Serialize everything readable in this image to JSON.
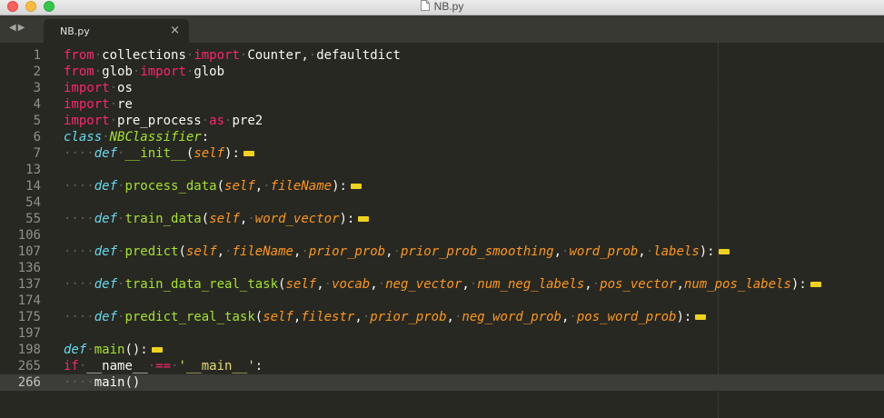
{
  "window": {
    "title": "NB.py"
  },
  "tabs": [
    {
      "label": "NB.py",
      "close": "×"
    }
  ],
  "lines": [
    {
      "n": "1",
      "tokens": [
        [
          "kw",
          "from"
        ],
        [
          "ws",
          "·"
        ],
        [
          "",
          "collections"
        ],
        [
          "ws",
          "·"
        ],
        [
          "kw",
          "import"
        ],
        [
          "ws",
          "·"
        ],
        [
          "",
          "Counter,"
        ],
        [
          "ws",
          "·"
        ],
        [
          "",
          "defaultdict"
        ]
      ]
    },
    {
      "n": "2",
      "tokens": [
        [
          "kw",
          "from"
        ],
        [
          "ws",
          "·"
        ],
        [
          "",
          "glob"
        ],
        [
          "ws",
          "·"
        ],
        [
          "kw",
          "import"
        ],
        [
          "ws",
          "·"
        ],
        [
          "",
          "glob"
        ]
      ]
    },
    {
      "n": "3",
      "tokens": [
        [
          "kw",
          "import"
        ],
        [
          "ws",
          "·"
        ],
        [
          "",
          "os"
        ]
      ]
    },
    {
      "n": "4",
      "tokens": [
        [
          "kw",
          "import"
        ],
        [
          "ws",
          "·"
        ],
        [
          "",
          "re"
        ]
      ]
    },
    {
      "n": "5",
      "tokens": [
        [
          "kw",
          "import"
        ],
        [
          "ws",
          "·"
        ],
        [
          "",
          "pre_process"
        ],
        [
          "ws",
          "·"
        ],
        [
          "kw",
          "as"
        ],
        [
          "ws",
          "·"
        ],
        [
          "",
          "pre2"
        ]
      ]
    },
    {
      "n": "6",
      "tokens": [
        [
          "st",
          "class"
        ],
        [
          "ws",
          "·"
        ],
        [
          "cl",
          "NBClassifier"
        ],
        [
          "",
          ":"
        ]
      ]
    },
    {
      "n": "7",
      "tokens": [
        [
          "ws",
          "····"
        ],
        [
          "st",
          "def"
        ],
        [
          "ws",
          "·"
        ],
        [
          "fn",
          "__init__"
        ],
        [
          "",
          "("
        ],
        [
          "pa",
          "self"
        ],
        [
          "",
          "):"
        ]
      ],
      "fold": true
    },
    {
      "n": "13",
      "tokens": []
    },
    {
      "n": "14",
      "tokens": [
        [
          "ws",
          "····"
        ],
        [
          "st",
          "def"
        ],
        [
          "ws",
          "·"
        ],
        [
          "fn",
          "process_data"
        ],
        [
          "",
          "("
        ],
        [
          "pa",
          "self"
        ],
        [
          "",
          ","
        ],
        [
          "ws",
          "·"
        ],
        [
          "pa",
          "fileName"
        ],
        [
          "",
          "):"
        ]
      ],
      "fold": true
    },
    {
      "n": "54",
      "tokens": []
    },
    {
      "n": "55",
      "tokens": [
        [
          "ws",
          "····"
        ],
        [
          "st",
          "def"
        ],
        [
          "ws",
          "·"
        ],
        [
          "fn",
          "train_data"
        ],
        [
          "",
          "("
        ],
        [
          "pa",
          "self"
        ],
        [
          "",
          ","
        ],
        [
          "ws",
          "·"
        ],
        [
          "pa",
          "word_vector"
        ],
        [
          "",
          "):"
        ]
      ],
      "fold": true
    },
    {
      "n": "106",
      "tokens": []
    },
    {
      "n": "107",
      "tokens": [
        [
          "ws",
          "····"
        ],
        [
          "st",
          "def"
        ],
        [
          "ws",
          "·"
        ],
        [
          "fn",
          "predict"
        ],
        [
          "",
          "("
        ],
        [
          "pa",
          "self"
        ],
        [
          "",
          ","
        ],
        [
          "ws",
          "·"
        ],
        [
          "pa",
          "fileName"
        ],
        [
          "",
          ","
        ],
        [
          "ws",
          "·"
        ],
        [
          "pa",
          "prior_prob"
        ],
        [
          "",
          ","
        ],
        [
          "ws",
          "·"
        ],
        [
          "pa",
          "prior_prob_smoothing"
        ],
        [
          "",
          ","
        ],
        [
          "ws",
          "·"
        ],
        [
          "pa",
          "word_prob"
        ],
        [
          "",
          ","
        ],
        [
          "ws",
          "·"
        ],
        [
          "pa",
          "labels"
        ],
        [
          "",
          "):"
        ]
      ],
      "fold": true
    },
    {
      "n": "136",
      "tokens": []
    },
    {
      "n": "137",
      "tokens": [
        [
          "ws",
          "····"
        ],
        [
          "st",
          "def"
        ],
        [
          "ws",
          "·"
        ],
        [
          "fn",
          "train_data_real_task"
        ],
        [
          "",
          "("
        ],
        [
          "pa",
          "self"
        ],
        [
          "",
          ","
        ],
        [
          "ws",
          "·"
        ],
        [
          "pa",
          "vocab"
        ],
        [
          "",
          ","
        ],
        [
          "ws",
          "·"
        ],
        [
          "pa",
          "neg_vector"
        ],
        [
          "",
          ","
        ],
        [
          "ws",
          "·"
        ],
        [
          "pa",
          "num_neg_labels"
        ],
        [
          "",
          ","
        ],
        [
          "ws",
          "·"
        ],
        [
          "pa",
          "pos_vector"
        ],
        [
          "",
          ","
        ],
        [
          "pa",
          "num_pos_labels"
        ],
        [
          "",
          "):"
        ]
      ],
      "fold": true
    },
    {
      "n": "174",
      "tokens": []
    },
    {
      "n": "175",
      "tokens": [
        [
          "ws",
          "····"
        ],
        [
          "st",
          "def"
        ],
        [
          "ws",
          "·"
        ],
        [
          "fn",
          "predict_real_task"
        ],
        [
          "",
          "("
        ],
        [
          "pa",
          "self"
        ],
        [
          "",
          ","
        ],
        [
          "pa",
          "filestr"
        ],
        [
          "",
          ","
        ],
        [
          "ws",
          "·"
        ],
        [
          "pa",
          "prior_prob"
        ],
        [
          "",
          ","
        ],
        [
          "ws",
          "·"
        ],
        [
          "pa",
          "neg_word_prob"
        ],
        [
          "",
          ","
        ],
        [
          "ws",
          "·"
        ],
        [
          "pa",
          "pos_word_prob"
        ],
        [
          "",
          "):"
        ]
      ],
      "fold": true
    },
    {
      "n": "197",
      "tokens": []
    },
    {
      "n": "198",
      "tokens": [
        [
          "st",
          "def"
        ],
        [
          "ws",
          "·"
        ],
        [
          "fn",
          "main"
        ],
        [
          "",
          "():"
        ]
      ],
      "fold": true
    },
    {
      "n": "265",
      "tokens": [
        [
          "kw",
          "if"
        ],
        [
          "ws",
          "·"
        ],
        [
          "",
          "__name__"
        ],
        [
          "ws",
          "·"
        ],
        [
          "op",
          "=="
        ],
        [
          "ws",
          "·"
        ],
        [
          "strg",
          "'__main__'"
        ],
        [
          "",
          ":"
        ]
      ]
    },
    {
      "n": "266",
      "tokens": [
        [
          "ws",
          "····"
        ],
        [
          "",
          "main"
        ],
        [
          "",
          "()"
        ]
      ],
      "current": true
    }
  ]
}
